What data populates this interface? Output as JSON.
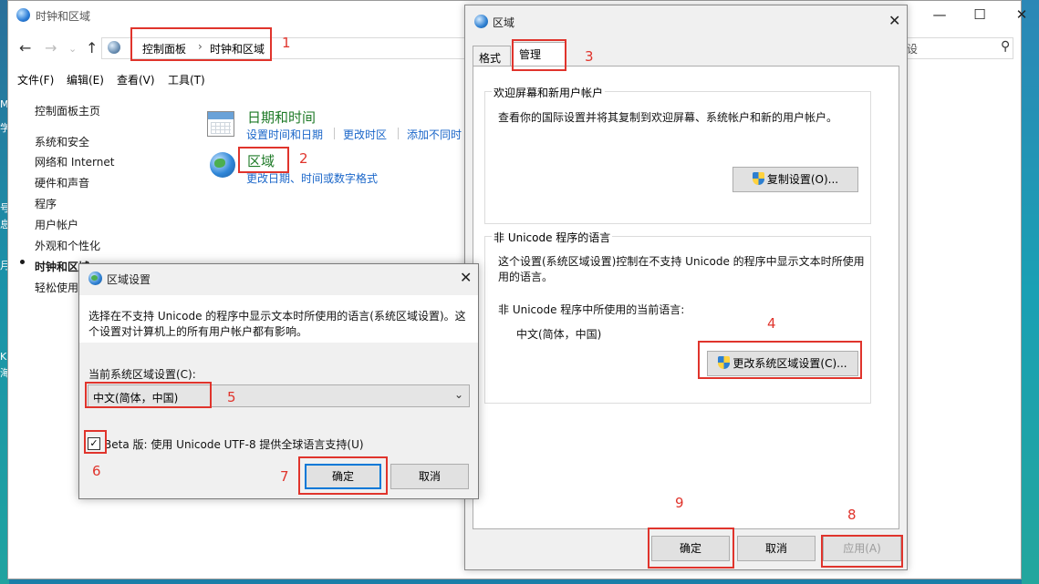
{
  "control_panel": {
    "title": "时钟和区域",
    "breadcrumb": [
      "控制面板",
      "时钟和区域"
    ],
    "menu": [
      "文件(F)",
      "编辑(E)",
      "查看(V)",
      "工具(T)"
    ],
    "sidebar": [
      "控制面板主页",
      "系统和安全",
      "网络和 Internet",
      "硬件和声音",
      "程序",
      "用户帐户",
      "外观和个性化",
      "时钟和区域",
      "轻松使用"
    ],
    "categories": {
      "datetime": {
        "title": "日期和时间",
        "links": [
          "设置时间和日期",
          "更改时区",
          "添加不同时"
        ]
      },
      "region": {
        "title": "区域",
        "links": [
          "更改日期、时间或数字格式"
        ]
      }
    },
    "partial_text": "设"
  },
  "region_dialog": {
    "title": "区域",
    "tabs": [
      "格式",
      "管理"
    ],
    "welcome_group": {
      "label": "欢迎屏幕和新用户帐户",
      "text": "查看你的国际设置并将其复制到欢迎屏幕、系统帐户和新的用户帐户。",
      "button": "复制设置(O)..."
    },
    "unicode_group": {
      "label": "非 Unicode 程序的语言",
      "text_line1": "这个设置(系统区域设置)控制在不支持 Unicode 的程序中显示文本时所使用",
      "text_line2": "用的语言。",
      "current_label": "非 Unicode 程序中所使用的当前语言:",
      "current_value": "中文(简体，中国)",
      "button": "更改系统区域设置(C)..."
    },
    "buttons": {
      "ok": "确定",
      "cancel": "取消",
      "apply": "应用(A)"
    }
  },
  "region_settings_dialog": {
    "title": "区域设置",
    "desc_line1": "选择在不支持 Unicode 的程序中显示文本时所使用的语言(系统区域设置)。这",
    "desc_line2": "个设置对计算机上的所有用户帐户都有影响。",
    "current_label": "当前系统区域设置(C):",
    "current_value": "中文(简体，中国)",
    "checkbox_label": "Beta 版: 使用 Unicode UTF-8 提供全球语言支持(U)",
    "checkbox_checked": true,
    "ok": "确定",
    "cancel": "取消"
  },
  "annotations": [
    "1",
    "2",
    "3",
    "4",
    "5",
    "6",
    "7",
    "8",
    "9"
  ],
  "desktop_glyphs": [
    "K",
    "海",
    "号",
    "息",
    "月",
    "学",
    "M"
  ],
  "colors": {
    "annotation_red": "#e0342c",
    "link_blue": "#1a66c9",
    "category_green": "#1e7a27",
    "focus_blue": "#0078d7"
  }
}
